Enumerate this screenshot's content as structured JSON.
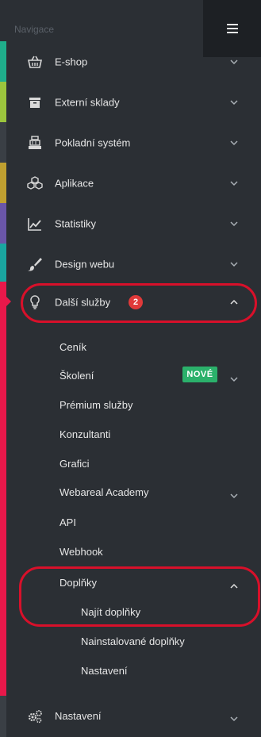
{
  "nav": {
    "title": "Navigace"
  },
  "menu": [
    {
      "label": "E-shop",
      "icon": "basket-icon",
      "stripe": "#1fae8b"
    },
    {
      "label": "Externí sklady",
      "icon": "archive-box-icon",
      "stripe": "#9bc53d"
    },
    {
      "label": "Pokladní systém",
      "icon": "cash-register-icon",
      "stripe": "#3a3f45"
    },
    {
      "label": "Aplikace",
      "icon": "cubes-icon",
      "stripe": "#c0a030"
    },
    {
      "label": "Statistiky",
      "icon": "line-chart-icon",
      "stripe": "#6a56a8"
    },
    {
      "label": "Design webu",
      "icon": "paint-brush-icon",
      "stripe": "#1aa6a0"
    },
    {
      "label": "Další služby",
      "icon": "lightbulb-icon",
      "stripe": "#e8184a",
      "badge": "2"
    }
  ],
  "submenu": [
    {
      "label": "Ceník"
    },
    {
      "label": "Školení",
      "tag": "NOVÉ"
    },
    {
      "label": "Prémium služby"
    },
    {
      "label": "Konzultanti"
    },
    {
      "label": "Grafici"
    },
    {
      "label": "Webareal Academy"
    },
    {
      "label": "API"
    },
    {
      "label": "Webhook"
    },
    {
      "label": "Doplňky"
    }
  ],
  "subsub": [
    {
      "label": "Najít doplňky"
    },
    {
      "label": "Nainstalované doplňky"
    },
    {
      "label": "Nastavení"
    }
  ],
  "bottom": {
    "label": "Nastavení",
    "icon": "gears-icon"
  },
  "colors": {
    "background": "#2b2f34",
    "header_button": "#1d2024",
    "active": "#e8184a",
    "badge": "#e03a3a",
    "new_tag": "#2bb16b",
    "annotation": "#d8102a"
  }
}
